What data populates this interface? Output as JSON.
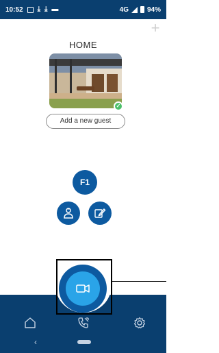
{
  "status_bar": {
    "time": "10:52",
    "network": "4G",
    "battery": "94%"
  },
  "header": {
    "add_icon": "plus-icon"
  },
  "home": {
    "title": "HOME",
    "image_icon": "home-photo",
    "verified_icon": "check-icon"
  },
  "guest": {
    "button_label": "Add a new guest"
  },
  "actions": {
    "f1_label": "F1",
    "user_icon": "person-badge-icon",
    "edit_icon": "pencil-icon"
  },
  "fab": {
    "icon": "video-camera-icon"
  },
  "bottom_nav": {
    "items": [
      {
        "icon": "home-icon"
      },
      {
        "icon": "phone-call-icon"
      },
      {
        "icon": "gear-icon"
      }
    ]
  },
  "colors": {
    "primary": "#0d5aa0",
    "nav": "#0a3f6f",
    "accent": "#2aa4e8",
    "success": "#4cc06a"
  }
}
